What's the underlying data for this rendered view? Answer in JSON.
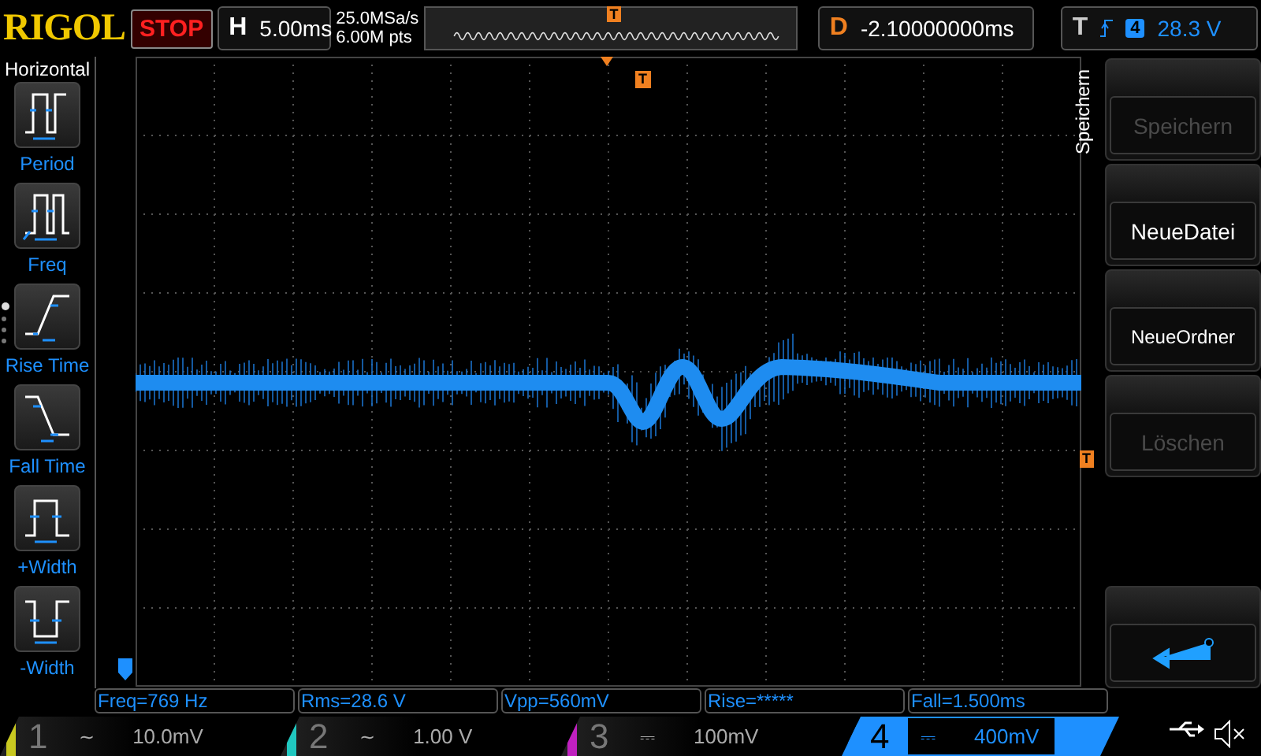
{
  "top_bar": {
    "logo": "RIGOL",
    "run_state": "STOP",
    "timebase": {
      "label": "H",
      "value": "5.00ms"
    },
    "sample_rate": "25.0MSa/s",
    "memory_depth": "6.00M pts",
    "overview_marker": "T",
    "delay": {
      "label": "D",
      "value": "-2.10000000ms"
    },
    "trigger": {
      "label": "T",
      "source": "4",
      "level": "28.3 V"
    }
  },
  "sidebar": {
    "title": "Horizontal",
    "page_dots": [
      {
        "selected": true
      },
      {
        "selected": false
      },
      {
        "selected": false
      },
      {
        "selected": false
      }
    ],
    "items": [
      {
        "label": "Period",
        "kind": "period"
      },
      {
        "label": "Freq",
        "kind": "freq"
      },
      {
        "label": "Rise Time",
        "kind": "rise"
      },
      {
        "label": "Fall Time",
        "kind": "fall"
      },
      {
        "label": "+Width",
        "kind": "pwidth"
      },
      {
        "label": "-Width",
        "kind": "nwidth"
      }
    ]
  },
  "screen": {
    "trigger_position_marker": "T",
    "trigger_level_marker": "T"
  },
  "measurements": [
    "Freq=769 Hz",
    "Rms=28.6 V",
    "Vpp=560mV",
    "Rise=*****",
    "Fall=1.500ms"
  ],
  "channels": [
    {
      "number": "1",
      "coupling": "~",
      "scale": "10.0mV",
      "color": "#c8c820",
      "selected": false
    },
    {
      "number": "2",
      "coupling": "~",
      "scale": "1.00 V",
      "color": "#20c8c0",
      "selected": false
    },
    {
      "number": "3",
      "coupling": "⎓",
      "scale": "100mV",
      "color": "#c020c0",
      "selected": false
    },
    {
      "number": "4",
      "coupling": "⎓",
      "scale": "400mV",
      "color": "#1e90ff",
      "selected": true
    }
  ],
  "menu": {
    "title": "Speichern",
    "buttons": [
      {
        "label": "Speichern",
        "disabled": true,
        "kind": "text"
      },
      {
        "label": "NeueDatei",
        "disabled": false,
        "kind": "text"
      },
      {
        "label": "NeueOrdner",
        "disabled": false,
        "kind": "text"
      },
      {
        "label": "Löschen",
        "disabled": true,
        "kind": "text"
      },
      {
        "kind": "spacer"
      },
      {
        "kind": "back",
        "disabled": false
      }
    ]
  }
}
